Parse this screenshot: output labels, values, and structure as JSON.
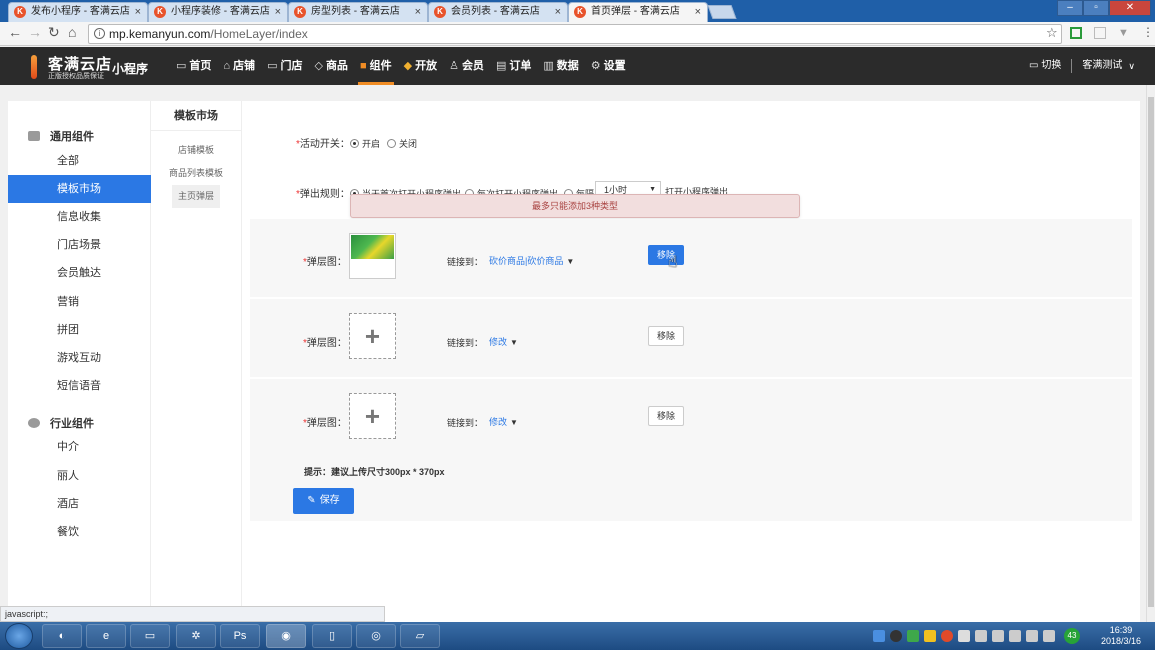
{
  "browser": {
    "tabs": [
      {
        "title": "发布小程序 - 客满云店",
        "fav": "K"
      },
      {
        "title": "小程序装修 - 客满云店",
        "fav": "K"
      },
      {
        "title": "房型列表 - 客满云店",
        "fav": "K"
      },
      {
        "title": "会员列表 - 客满云店",
        "fav": "K"
      },
      {
        "title": "首页弹层 - 客满云店",
        "fav": "K"
      }
    ],
    "close_glyph": "×",
    "url_host": "mp.kemanyun.com",
    "url_path": "/HomeLayer/index",
    "status_text": "javascript:;"
  },
  "header": {
    "logo": "客满云店",
    "logo_sub": "正版授权品质保证",
    "app_name": "小程序",
    "nav": [
      {
        "label": "首页",
        "icon": "▭"
      },
      {
        "label": "店铺",
        "icon": "⌂"
      },
      {
        "label": "门店",
        "icon": "▭"
      },
      {
        "label": "商品",
        "icon": "◇"
      },
      {
        "label": "组件",
        "icon": "■"
      },
      {
        "label": "开放",
        "icon": "◆"
      },
      {
        "label": "会员",
        "icon": "♙"
      },
      {
        "label": "订单",
        "icon": "▤"
      },
      {
        "label": "数据",
        "icon": "▥"
      },
      {
        "label": "设置",
        "icon": "⚙"
      }
    ],
    "switch_label": "切换",
    "account": "客满测试"
  },
  "sidebar": {
    "group1": "通用组件",
    "group1_items": [
      "全部",
      "模板市场",
      "信息收集",
      "门店场景",
      "会员触达",
      "营销",
      "拼团",
      "游戏互动",
      "短信语音"
    ],
    "group2": "行业组件",
    "group2_items": [
      "中介",
      "丽人",
      "酒店",
      "餐饮"
    ]
  },
  "subnav": {
    "title": "模板市场",
    "items": [
      "店铺模板",
      "商品列表模板",
      "主页弹层"
    ]
  },
  "form": {
    "switch_label": "活动开关：",
    "switch_on": "开启",
    "switch_off": "关闭",
    "rule_label": "弹出规则：",
    "rule_opt1": "当天首次打开小程序弹出",
    "rule_opt2": "每次打开小程序弹出",
    "rule_opt3": "每隔",
    "rule_interval": "1小时",
    "rule_suffix": "打开小程序弹出",
    "toast": "最多只能添加3种类型",
    "layer_label": "弹层图：",
    "link_label": "链接到：",
    "rows": [
      {
        "link": "砍价商品|砍价商品",
        "remove": "移除"
      },
      {
        "link": "修改",
        "remove": "移除"
      },
      {
        "link": "修改",
        "remove": "移除"
      }
    ],
    "hint": "提示：建议上传尺寸300px * 370px",
    "save": "保存"
  },
  "taskbar": {
    "time": "16:39",
    "date": "2018/3/16",
    "badge": "43"
  }
}
